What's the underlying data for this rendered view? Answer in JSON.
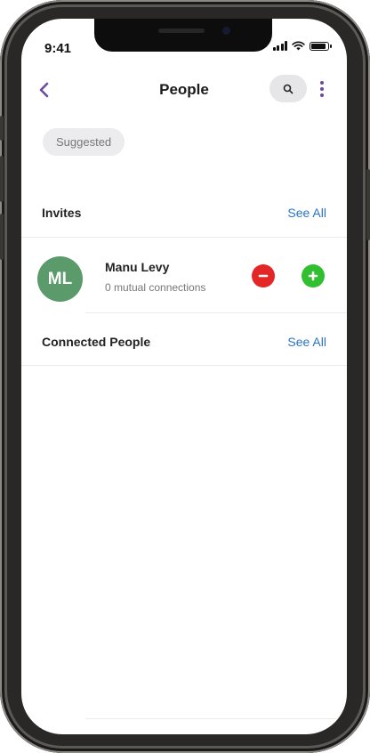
{
  "status_bar": {
    "time": "9:41"
  },
  "header": {
    "title": "People",
    "back_icon": "chevron-left-icon",
    "search_icon": "search-icon",
    "more_icon": "more-vertical-icon"
  },
  "filter": {
    "chip_label": "Suggested"
  },
  "invites": {
    "title": "Invites",
    "see_all": "See All",
    "items": [
      {
        "initials": "ML",
        "name": "Manu Levy",
        "subtitle": "0 mutual connections",
        "avatar_color": "#5a9a6b"
      }
    ]
  },
  "connected": {
    "title": "Connected People",
    "see_all": "See All"
  },
  "colors": {
    "accent": "#6b4aa0",
    "link": "#2a74c9",
    "reject": "#e52626",
    "accept": "#2fbf2f"
  }
}
